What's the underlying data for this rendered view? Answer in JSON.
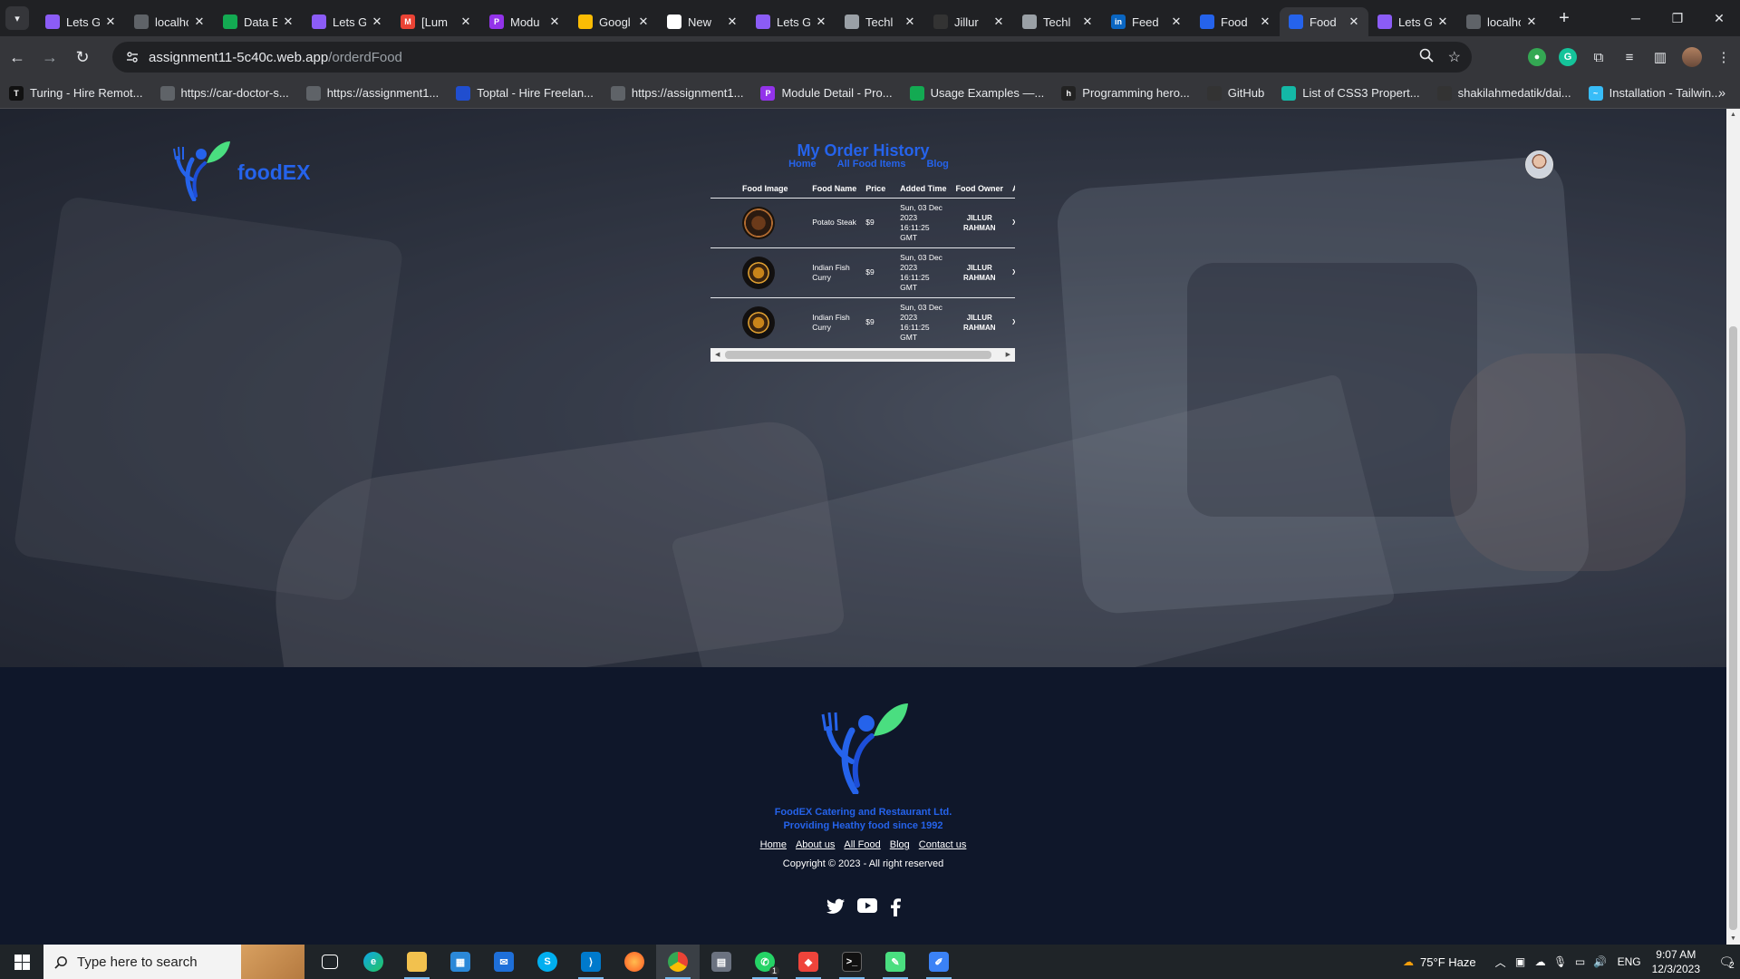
{
  "browser": {
    "tabs": [
      {
        "title": "Lets Ge",
        "color": "#8b5cf6",
        "glyph": ""
      },
      {
        "title": "localho",
        "color": "#5f6368",
        "glyph": ""
      },
      {
        "title": "Data E",
        "color": "#13aa52",
        "glyph": ""
      },
      {
        "title": "Lets Ge",
        "color": "#8b5cf6",
        "glyph": ""
      },
      {
        "title": "[Lum",
        "color": "#ea4335",
        "glyph": "M"
      },
      {
        "title": "Modu",
        "color": "#9333ea",
        "glyph": "P"
      },
      {
        "title": "Googl",
        "color": "#fbbc04",
        "glyph": ""
      },
      {
        "title": "New",
        "color": "#ffffff",
        "glyph": ""
      },
      {
        "title": "Lets Ge",
        "color": "#8b5cf6",
        "glyph": ""
      },
      {
        "title": "Techl",
        "color": "#9aa0a6",
        "glyph": ""
      },
      {
        "title": "Jillur",
        "color": "#333333",
        "glyph": ""
      },
      {
        "title": "Techl",
        "color": "#9aa0a6",
        "glyph": ""
      },
      {
        "title": "Feed",
        "color": "#0a66c2",
        "glyph": "in"
      },
      {
        "title": "Food",
        "color": "#2563eb",
        "glyph": ""
      },
      {
        "title": "Food",
        "color": "#2563eb",
        "glyph": ""
      },
      {
        "title": "Lets Ge",
        "color": "#8b5cf6",
        "glyph": ""
      },
      {
        "title": "localho",
        "color": "#5f6368",
        "glyph": ""
      }
    ],
    "active_tab_index": 14,
    "url_host": "assignment11-5c40c.web.app",
    "url_path": "/orderdFood",
    "bookmarks": [
      {
        "label": "Turing - Hire Remot...",
        "color": "#111111",
        "glyph": "T"
      },
      {
        "label": "https://car-doctor-s...",
        "color": "#5f6368",
        "glyph": ""
      },
      {
        "label": "https://assignment1...",
        "color": "#5f6368",
        "glyph": ""
      },
      {
        "label": "Toptal - Hire Freelan...",
        "color": "#204ecf",
        "glyph": ""
      },
      {
        "label": "https://assignment1...",
        "color": "#5f6368",
        "glyph": ""
      },
      {
        "label": "Module Detail - Pro...",
        "color": "#9333ea",
        "glyph": "P"
      },
      {
        "label": "Usage Examples —...",
        "color": "#13aa52",
        "glyph": ""
      },
      {
        "label": "Programming hero...",
        "color": "#222222",
        "glyph": "h"
      },
      {
        "label": "GitHub",
        "color": "#333333",
        "glyph": ""
      },
      {
        "label": "List of CSS3 Propert...",
        "color": "#14b8a6",
        "glyph": ""
      },
      {
        "label": "shakilahmedatik/dai...",
        "color": "#333333",
        "glyph": ""
      },
      {
        "label": "Installation - Tailwin...",
        "color": "#38bdf8",
        "glyph": "~"
      }
    ]
  },
  "site": {
    "brand": "foodEX",
    "page_title": "My Order History",
    "nav": {
      "home": "Home",
      "all_food": "All Food Items",
      "blog": "Blog"
    },
    "table": {
      "headers": [
        "Food Image",
        "Food Name",
        "Price",
        "Added Time",
        "Food Owner",
        "Acti"
      ],
      "rows": [
        {
          "name": "Potato Steak",
          "price": "$9",
          "time": "Sun, 03 Dec 2023 16:11:25 GMT",
          "owner": "JILLUR RAHMAN",
          "action": "X",
          "thumb": "steak"
        },
        {
          "name": "Indian Fish Curry",
          "price": "$9",
          "time": "Sun, 03 Dec 2023 16:11:25 GMT",
          "owner": "JILLUR RAHMAN",
          "action": "X",
          "thumb": "curry"
        },
        {
          "name": "Indian Fish Curry",
          "price": "$9",
          "time": "Sun, 03 Dec 2023 16:11:25 GMT",
          "owner": "JILLUR RAHMAN",
          "action": "X",
          "thumb": "curry"
        }
      ]
    },
    "footer": {
      "company": "FoodEX Catering and Restaurant Ltd.",
      "tagline": "Providing Heathy food since 1992",
      "links": {
        "home": "Home",
        "about": "About us",
        "all_food": "All Food",
        "blog": "Blog",
        "contact": "Contact us"
      },
      "copyright": "Copyright © 2023 - All right reserved"
    },
    "colors": {
      "brand_blue": "#2563eb",
      "footer_bg": "#0f172a"
    }
  },
  "taskbar": {
    "search_placeholder": "Type here to search",
    "weather": "75°F  Haze",
    "language": "ENG",
    "time": "9:07 AM",
    "date": "12/3/2023",
    "notification_count": "2",
    "whatsapp_badge": "1"
  }
}
